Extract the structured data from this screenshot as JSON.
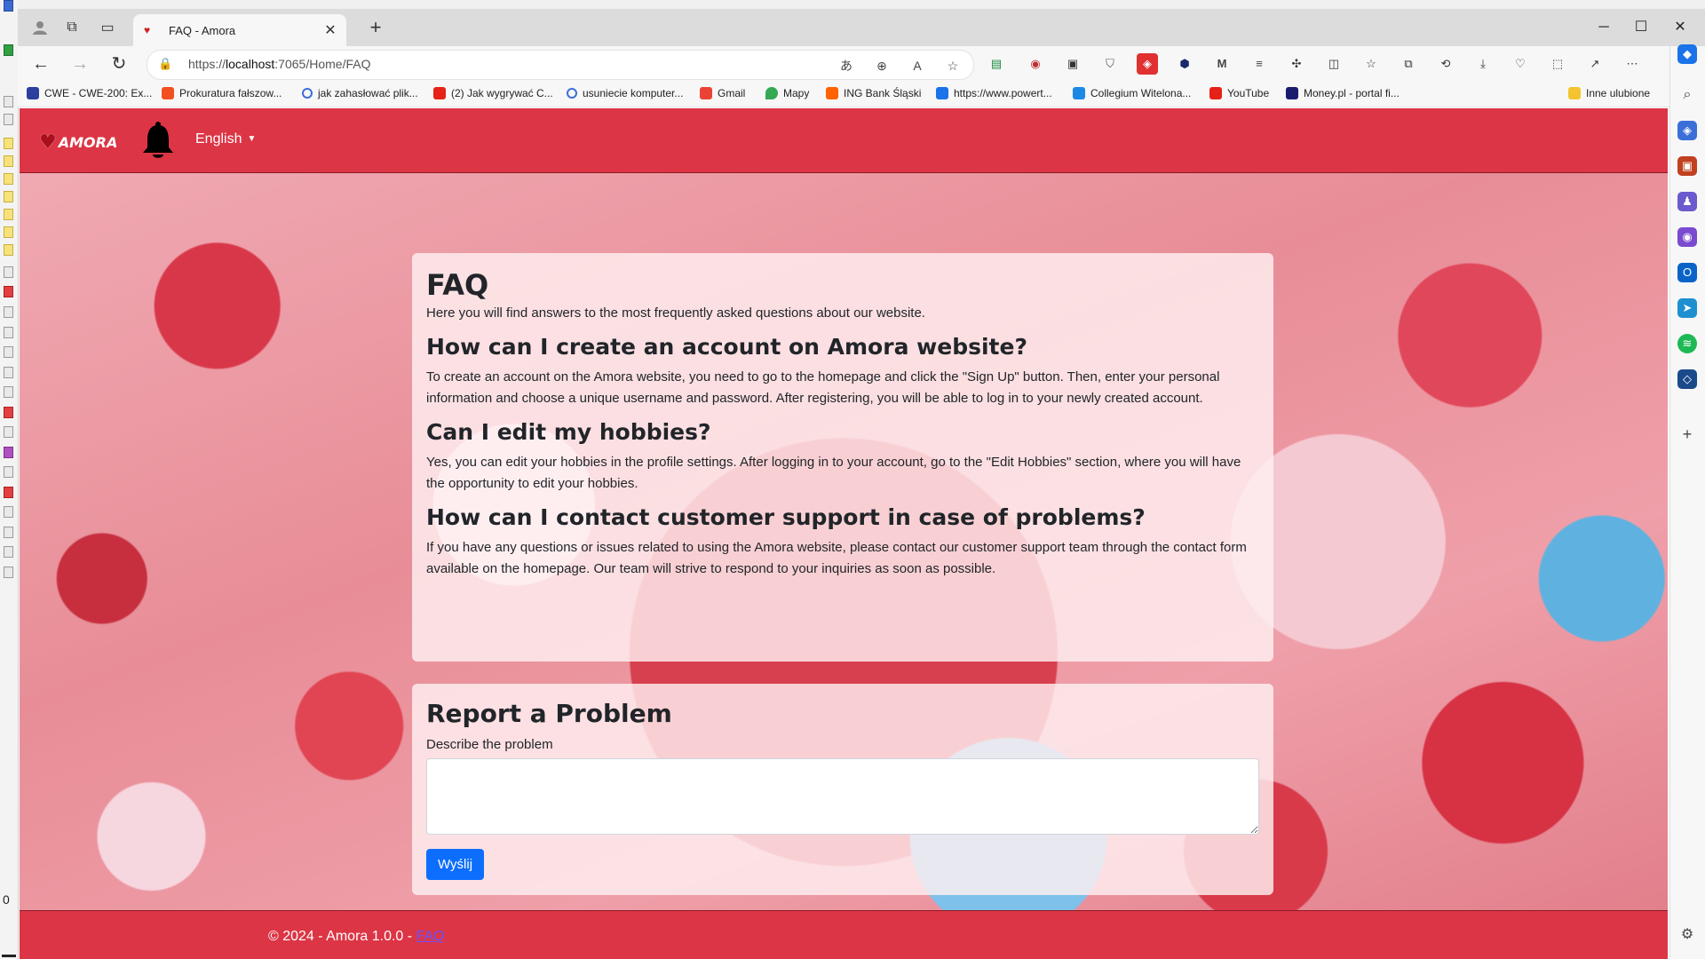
{
  "browser": {
    "tab_title": "FAQ - Amora",
    "url_prefix": "https://",
    "url_host": "localhost",
    "url_rest": ":7065/Home/FAQ"
  },
  "bookmarks": [
    {
      "label": "CWE - CWE-200: Ex...",
      "color": "#2a3f9e"
    },
    {
      "label": "Prokuratura fałszow...",
      "color": "#f25022"
    },
    {
      "label": "jak zahasłować plik...",
      "color": "#3b6fd8"
    },
    {
      "label": "(2) Jak wygrywać C...",
      "color": "#e62117"
    },
    {
      "label": "usuniecie komputer...",
      "color": "#3b6fd8"
    },
    {
      "label": "Gmail",
      "color": "#ea4335"
    },
    {
      "label": "Mapy",
      "color": "#34a853"
    },
    {
      "label": "ING Bank Śląski",
      "color": "#ff6200"
    },
    {
      "label": "https://www.powert...",
      "color": "#1a73e8"
    },
    {
      "label": "Collegium Witelona...",
      "color": "#1e88e5"
    },
    {
      "label": "YouTube",
      "color": "#e62117"
    },
    {
      "label": "Money.pl - portal fi...",
      "color": "#1b1b6e"
    },
    {
      "label": "Inne ulubione",
      "color": "#f4c430"
    }
  ],
  "site": {
    "brand": "AMORA",
    "language": "English",
    "footer_text": "© 2024 - Amora 1.0.0 - ",
    "footer_link": "FAQ"
  },
  "faq": {
    "title": "FAQ",
    "intro": "Here you will find answers to the most frequently asked questions about our website.",
    "items": [
      {
        "question": "How can I create an account on Amora website?",
        "answer": "To create an account on the Amora website, you need to go to the homepage and click the \"Sign Up\" button. Then, enter your personal information and choose a unique username and password. After registering, you will be able to log in to your newly created account."
      },
      {
        "question": "Can I edit my hobbies?",
        "answer": "Yes, you can edit your hobbies in the profile settings. After logging in to your account, go to the \"Edit Hobbies\" section, where you will have the opportunity to edit your hobbies."
      },
      {
        "question": "How can I contact customer support in case of problems?",
        "answer": "If you have any questions or issues related to using the Amora website, please contact our customer support team through the contact form available on the homepage. Our team will strive to respond to your inquiries as soon as possible."
      }
    ]
  },
  "report": {
    "title": "Report a Problem",
    "label": "Describe the problem",
    "value": "",
    "submit_label": "Wyślij"
  },
  "left_strip": {
    "indicator": "0"
  }
}
